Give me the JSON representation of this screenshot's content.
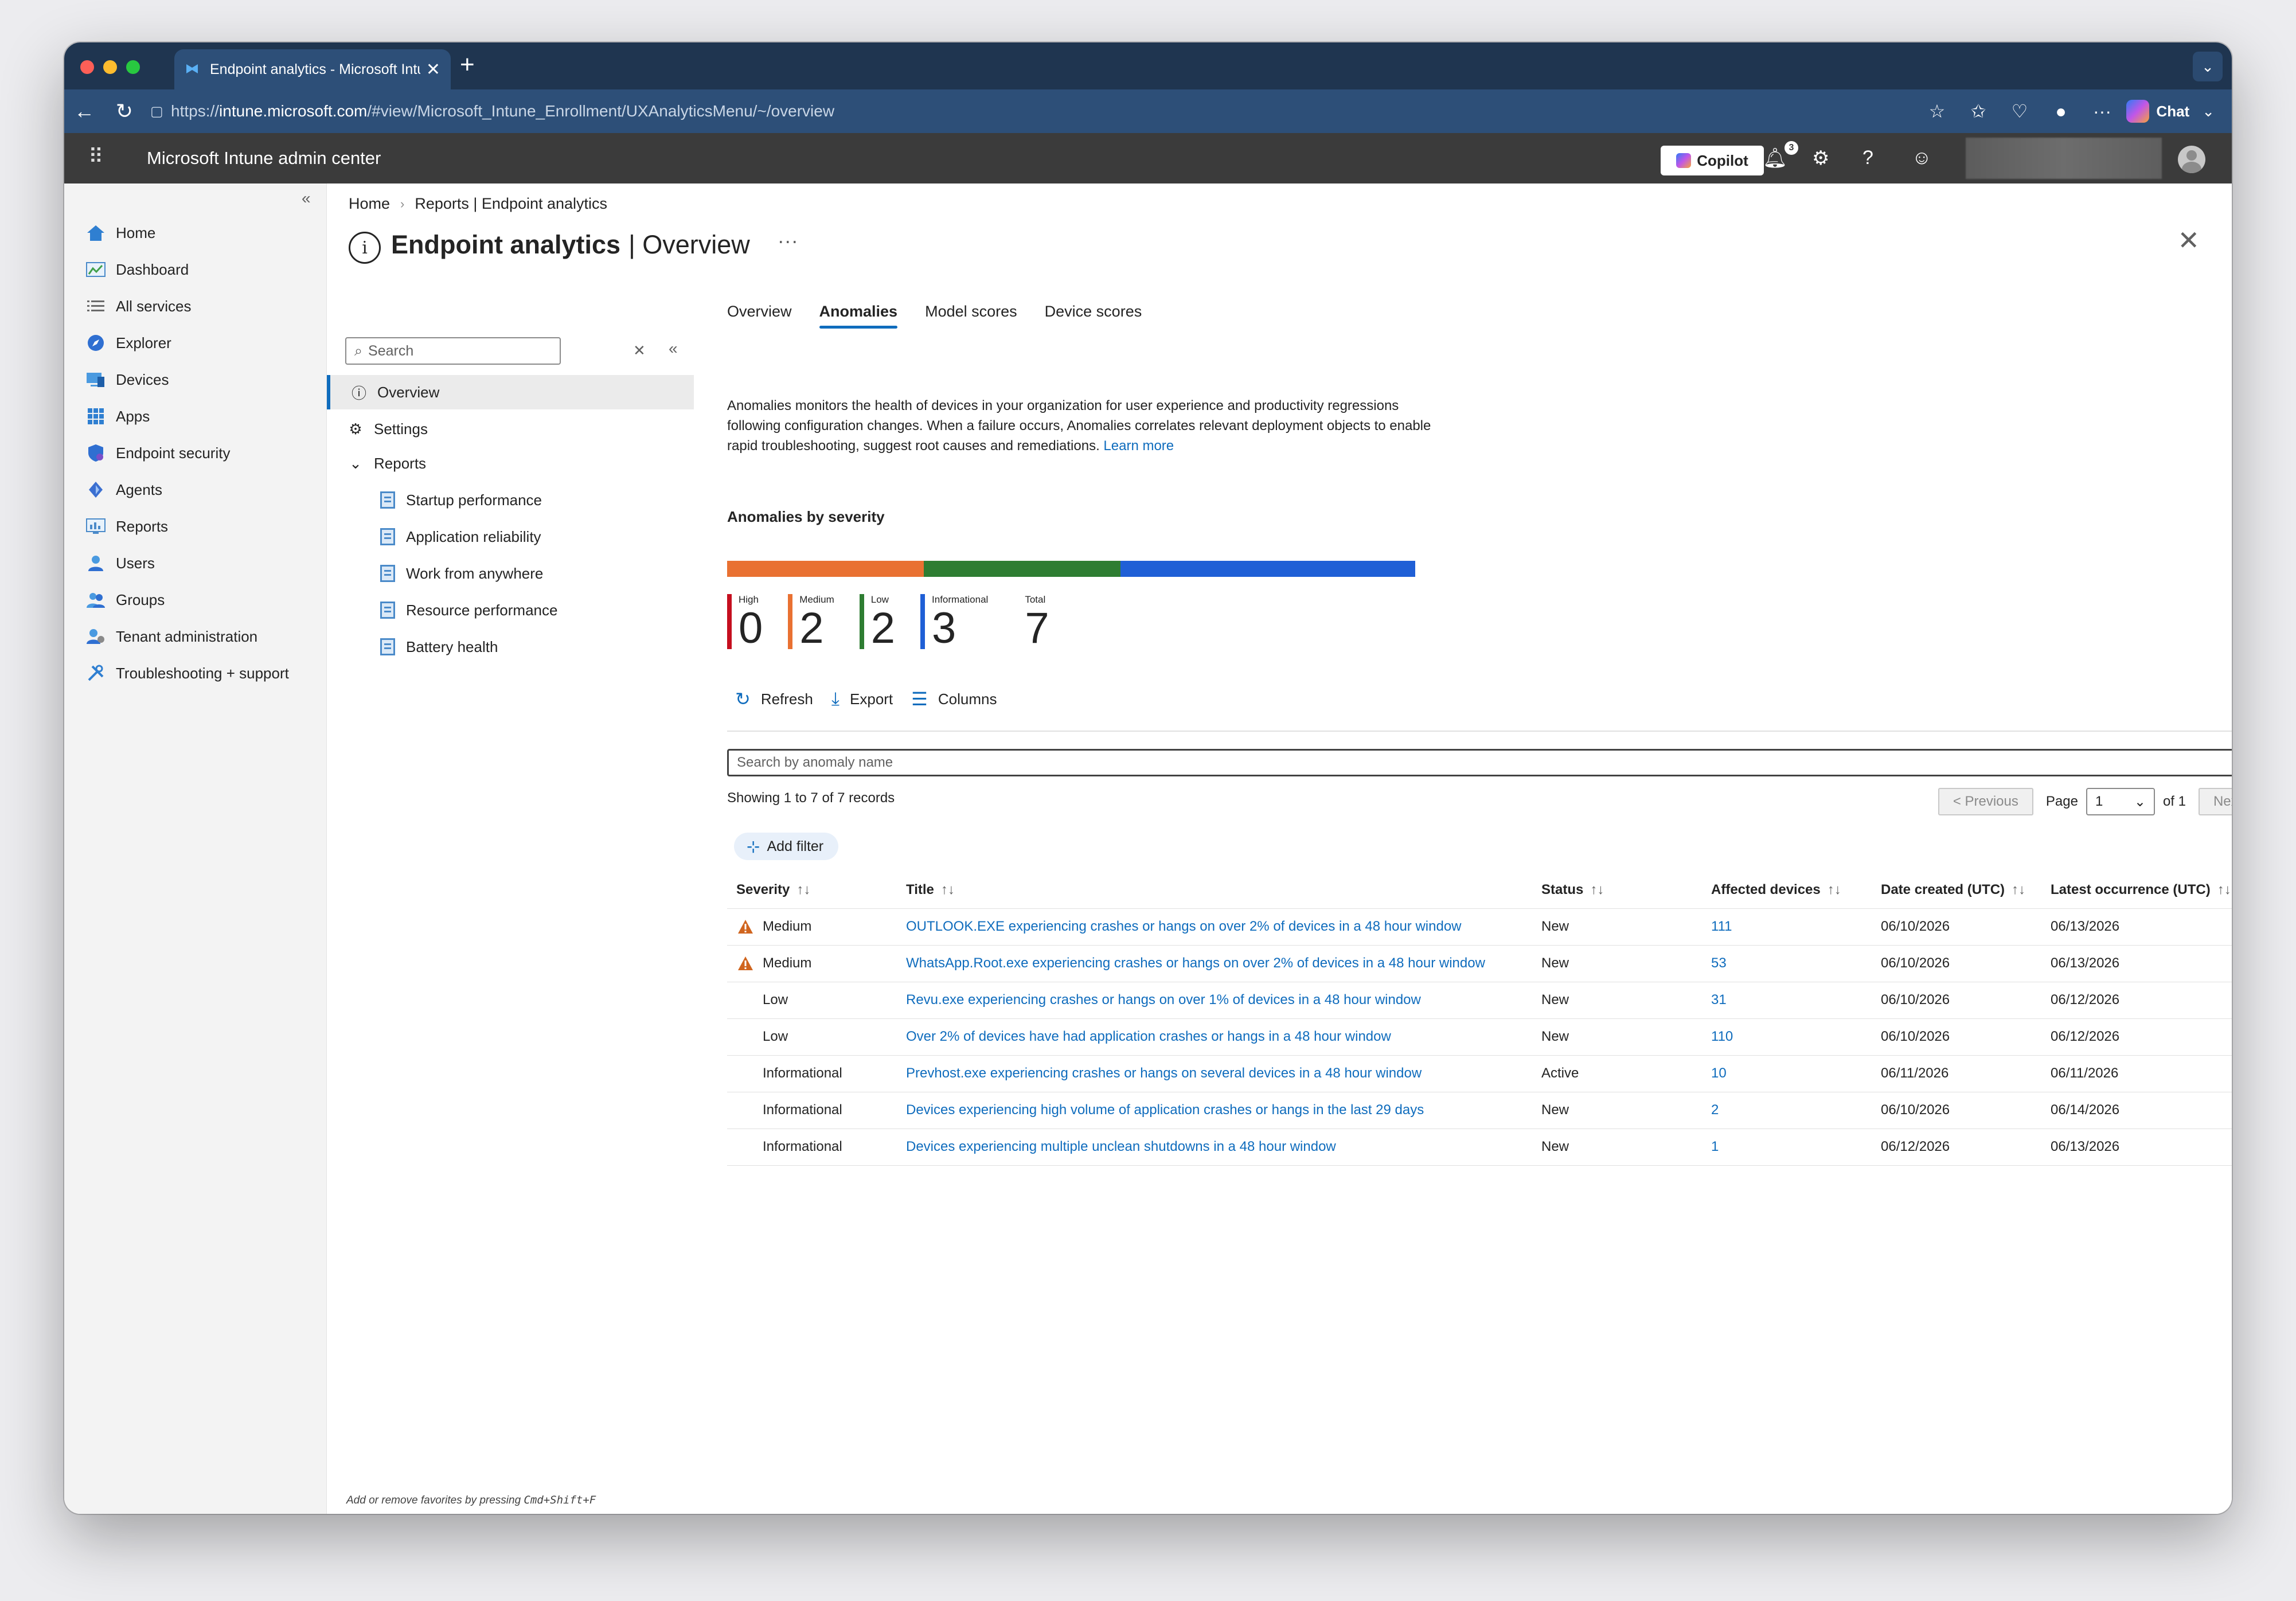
{
  "browser": {
    "tab_title": "Endpoint analytics - Microsoft Intune",
    "url_prefix": "https://",
    "url_host": "intune.microsoft.com",
    "url_path": "/#view/Microsoft_Intune_Enrollment/UXAnalyticsMenu/~/overview",
    "chat_label": "Chat"
  },
  "header": {
    "app_title": "Microsoft Intune admin center",
    "copilot_label": "Copilot",
    "notification_count": "3"
  },
  "leftnav": {
    "items": [
      {
        "label": "Home",
        "icon": "home-icon"
      },
      {
        "label": "Dashboard",
        "icon": "dashboard-icon"
      },
      {
        "label": "All services",
        "icon": "list-icon"
      },
      {
        "label": "Explorer",
        "icon": "explorer-icon"
      },
      {
        "label": "Devices",
        "icon": "devices-icon"
      },
      {
        "label": "Apps",
        "icon": "apps-icon"
      },
      {
        "label": "Endpoint security",
        "icon": "shield-icon"
      },
      {
        "label": "Agents",
        "icon": "agents-icon"
      },
      {
        "label": "Reports",
        "icon": "reports-icon"
      },
      {
        "label": "Users",
        "icon": "user-icon"
      },
      {
        "label": "Groups",
        "icon": "groups-icon"
      },
      {
        "label": "Tenant administration",
        "icon": "tenant-icon"
      },
      {
        "label": "Troubleshooting + support",
        "icon": "wrench-icon"
      }
    ]
  },
  "breadcrumb": {
    "home": "Home",
    "current": "Reports | Endpoint analytics"
  },
  "page": {
    "title_strong": "Endpoint analytics",
    "title_light": "| Overview",
    "more": "···"
  },
  "submenu": {
    "search_placeholder": "Search",
    "overview": "Overview",
    "settings": "Settings",
    "reports": "Reports",
    "children": [
      "Startup performance",
      "Application reliability",
      "Work from anywhere",
      "Resource performance",
      "Battery health"
    ]
  },
  "tabs": [
    "Overview",
    "Anomalies",
    "Model scores",
    "Device scores"
  ],
  "description": {
    "text": "Anomalies monitors the health of devices in your organization for user experience and productivity regressions following configuration changes. When a failure occurs, Anomalies correlates relevant deployment objects to enable rapid troubleshooting, suggest root causes and remediations.",
    "learn_more": "Learn more"
  },
  "severity": {
    "heading": "Anomalies by severity",
    "kpis": [
      {
        "label": "High",
        "value": "0",
        "color": "#c50f1f"
      },
      {
        "label": "Medium",
        "value": "2",
        "color": "#e97132"
      },
      {
        "label": "Low",
        "value": "2",
        "color": "#2e7d32"
      },
      {
        "label": "Informational",
        "value": "3",
        "color": "#1f5fd6"
      },
      {
        "label": "Total",
        "value": "7",
        "color": ""
      }
    ],
    "segments": [
      {
        "name": "Medium",
        "count": 2,
        "color": "#e97132"
      },
      {
        "name": "Low",
        "count": 2,
        "color": "#2e7d32"
      },
      {
        "name": "Informational",
        "count": 3,
        "color": "#1f5fd6"
      }
    ]
  },
  "toolbar": {
    "refresh": "Refresh",
    "export": "Export",
    "columns": "Columns"
  },
  "grid": {
    "search_placeholder": "Search by anomaly name",
    "records": "Showing 1 to 7 of 7 records",
    "prev": "< Previous",
    "page_label": "Page",
    "page_value": "1",
    "of_label": "of 1",
    "next": "Next >",
    "add_filter": "Add filter",
    "columns": [
      "Severity",
      "Title",
      "Status",
      "Affected devices",
      "Date created (UTC)",
      "Latest occurrence (UTC)"
    ],
    "rows": [
      {
        "severity": "Medium",
        "warn": true,
        "title": "OUTLOOK.EXE experiencing crashes or hangs on over 2% of devices in a 48 hour window",
        "status": "New",
        "affected": "111",
        "created": "06/10/2026",
        "latest": "06/13/2026"
      },
      {
        "severity": "Medium",
        "warn": true,
        "title": "WhatsApp.Root.exe experiencing crashes or hangs on over 2% of devices in a 48 hour window",
        "status": "New",
        "affected": "53",
        "created": "06/10/2026",
        "latest": "06/13/2026"
      },
      {
        "severity": "Low",
        "warn": false,
        "title": "Revu.exe experiencing crashes or hangs on over 1% of devices in a 48 hour window",
        "status": "New",
        "affected": "31",
        "created": "06/10/2026",
        "latest": "06/12/2026"
      },
      {
        "severity": "Low",
        "warn": false,
        "title": "Over 2% of devices have had application crashes or hangs in a 48 hour window",
        "status": "New",
        "affected": "110",
        "created": "06/10/2026",
        "latest": "06/12/2026"
      },
      {
        "severity": "Informational",
        "warn": false,
        "title": "Prevhost.exe experiencing crashes or hangs on several devices in a 48 hour window",
        "status": "Active",
        "affected": "10",
        "created": "06/11/2026",
        "latest": "06/11/2026"
      },
      {
        "severity": "Informational",
        "warn": false,
        "title": "Devices experiencing high volume of application crashes or hangs in the last 29 days",
        "status": "New",
        "affected": "2",
        "created": "06/10/2026",
        "latest": "06/14/2026"
      },
      {
        "severity": "Informational",
        "warn": false,
        "title": "Devices experiencing multiple unclean shutdowns in a 48 hour window",
        "status": "New",
        "affected": "1",
        "created": "06/12/2026",
        "latest": "06/13/2026"
      }
    ]
  },
  "footnote": {
    "text": "Add or remove favorites by pressing ",
    "keys": "Cmd+Shift+F"
  }
}
